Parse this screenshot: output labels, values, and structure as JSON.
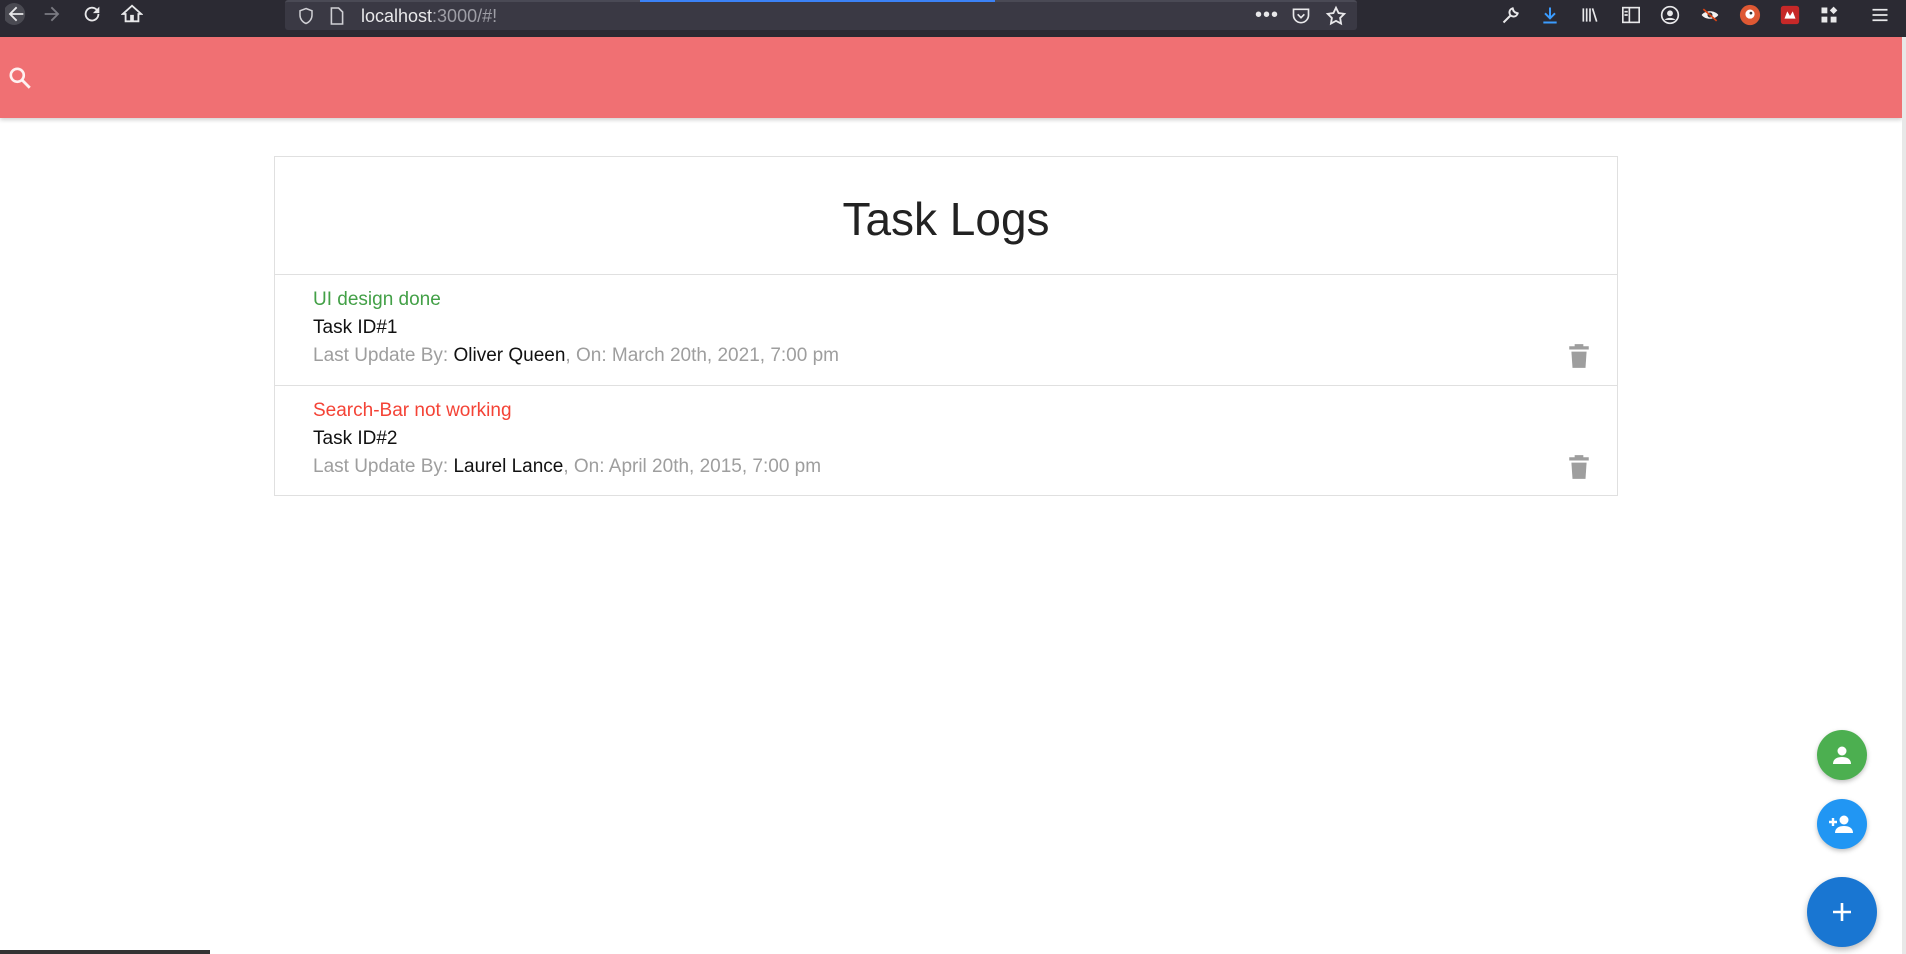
{
  "browser": {
    "url_host": "localhost",
    "url_rest": ":3000/#!"
  },
  "colors": {
    "header": "#f07073",
    "success": "#43a047",
    "danger": "#f44336",
    "fab_green": "#4caf50",
    "fab_blue": "#2196f3",
    "fab_main": "#1976d2"
  },
  "header": {
    "search_icon": "search-icon"
  },
  "logs": {
    "title": "Task Logs",
    "meta_prefix": "Last Update By: ",
    "meta_on": ", On: ",
    "items": [
      {
        "message": "UI design done",
        "status": "success",
        "task_id": "Task ID#1",
        "tech": "Oliver Queen",
        "date": "March 20th, 2021, 7:00 pm"
      },
      {
        "message": "Search-Bar not working",
        "status": "danger",
        "task_id": "Task ID#2",
        "tech": "Laurel Lance",
        "date": "April 20th, 2015, 7:00 pm"
      }
    ]
  },
  "fabs": {
    "person": "person-icon",
    "add_person": "person-add-icon",
    "add": "add-icon"
  }
}
